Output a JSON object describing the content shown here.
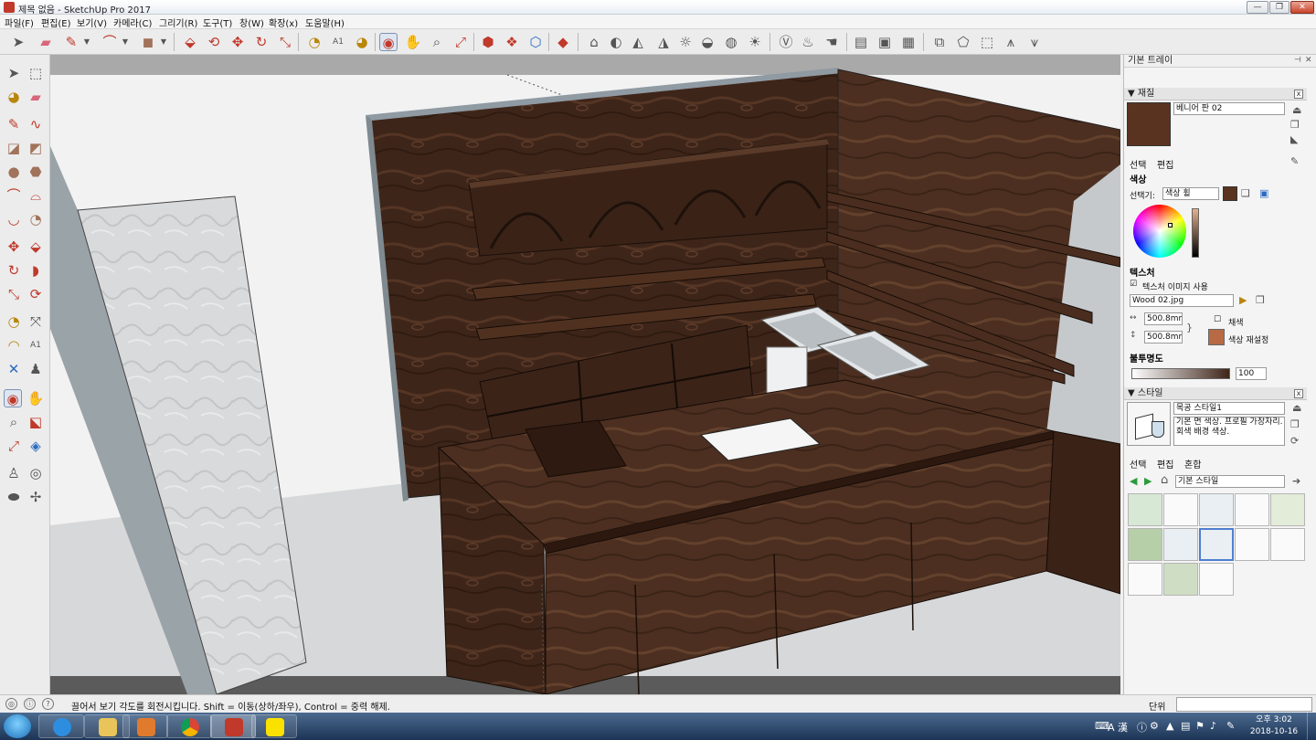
{
  "window": {
    "title": "제목 없음 - SketchUp Pro 2017",
    "buttons": [
      "minimize-icon",
      "restore-icon",
      "close-icon"
    ]
  },
  "menu": [
    "파일(F)",
    "편집(E)",
    "보기(V)",
    "카메라(C)",
    "그리기(R)",
    "도구(T)",
    "창(W)",
    "확장(x)",
    "도움말(H)"
  ],
  "toolbar_icons": [
    "select-arrow-icon",
    "eraser-icon",
    "pencil-line-icon",
    "arc-icon",
    "rectangle-icon",
    "push-pull-icon",
    "follow-me-icon",
    "move-icon",
    "rotate-icon",
    "scale-icon",
    "tape-measure-icon",
    "text-icon",
    "paint-bucket-icon",
    "orbit-icon",
    "pan-icon",
    "zoom-icon",
    "zoom-extents-icon",
    "warehouse-icon",
    "components-icon",
    "share-icon",
    "ruby-icon",
    "style-icons",
    "shadow-icons",
    "section-icons",
    "view-icons"
  ],
  "tray": {
    "title": "기본 트레이",
    "materials": {
      "header": "재질",
      "name_value": "베니어 판 02",
      "tabs": [
        "선택",
        "편집"
      ],
      "color_label": "색상",
      "picker_label": "선택기:",
      "picker_value": "색상 휠",
      "texture_label": "텍스처",
      "use_texture_label": "텍스처 이미지 사용",
      "texture_file": "Wood 02.jpg",
      "width_value": "500.8mm",
      "height_value": "500.8mm",
      "colorize_label": "채색",
      "reset_color_label": "색상 재설정",
      "opacity_label": "불투명도",
      "opacity_value": "100",
      "swatch_color": "#5a3320"
    },
    "styles": {
      "header": "스타일",
      "name_value": "목공 스타일1",
      "description": "기본 면 색상. 프로필 가장자리. 회색 배경 색상.",
      "tabs": [
        "선택",
        "편집",
        "혼합"
      ],
      "dropdown_value": "기본 스타일"
    }
  },
  "status": {
    "message": "끌어서 보기 각도를 회전시킵니다. Shift = 이동(상하/좌우), Control = 중력 해제.",
    "unit_label": "단위",
    "vcb_value": ""
  },
  "taskbar": {
    "time": "오후 3:02",
    "date": "2018-10-16",
    "ime": "A 漢",
    "apps": [
      "ie-icon",
      "explorer-icon",
      "media-player-icon",
      "chrome-icon",
      "sketchup-icon",
      "kakaotalk-icon"
    ]
  },
  "colors": {
    "wood_dark": "#3b2418",
    "wood_mid": "#4a2d1e",
    "wall_gray": "#cfd2d5",
    "floor": "#dcdcdc",
    "accent_blue": "#4f7fd1"
  }
}
